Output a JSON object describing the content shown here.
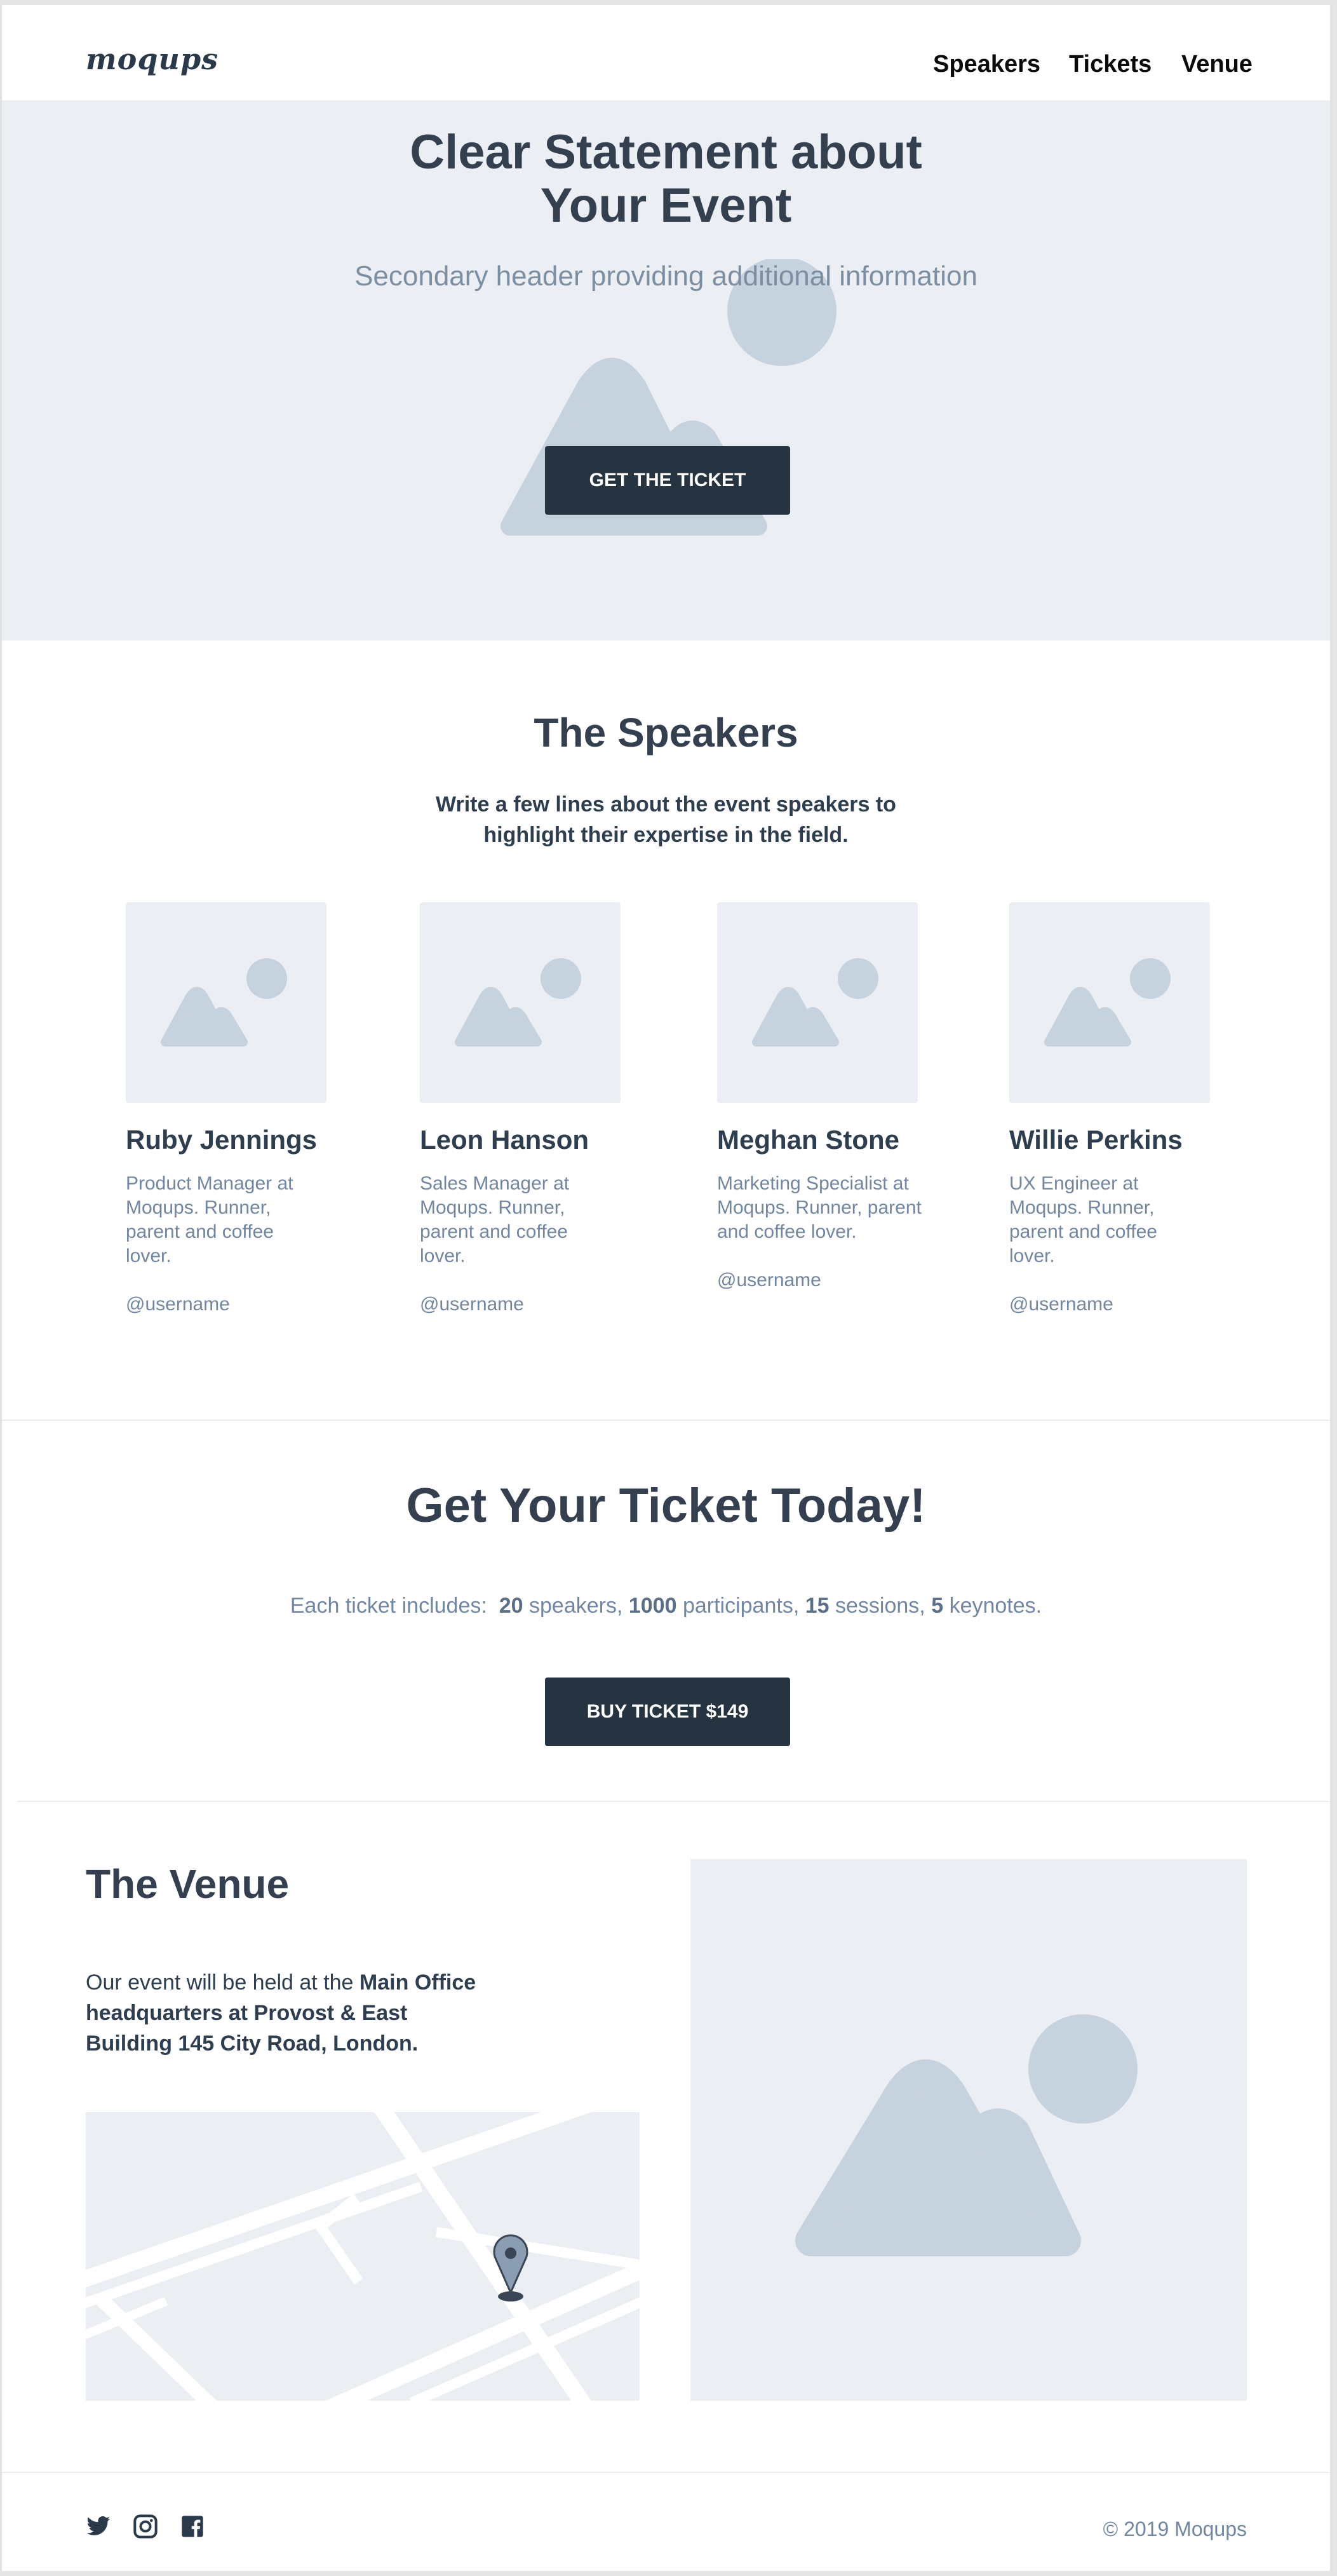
{
  "header": {
    "logo": "moqups",
    "nav": [
      "Speakers",
      "Tickets",
      "Venue"
    ]
  },
  "hero": {
    "title_line1": "Clear Statement about",
    "title_line2": "Your Event",
    "subtitle": "Secondary header providing additional information",
    "cta": "GET THE TICKET"
  },
  "speakers": {
    "title": "The Speakers",
    "intro_line1": "Write a few lines about the event speakers to",
    "intro_line2": "highlight their expertise in the field.",
    "items": [
      {
        "name": "Ruby Jennings",
        "bio": "Product Manager at Moqups. Runner, parent and coffee lover.",
        "username": "@username"
      },
      {
        "name": "Leon Hanson",
        "bio": "Sales Manager at Moqups.  Runner, parent and coffee lover.",
        "username": "@username"
      },
      {
        "name": "Meghan Stone",
        "bio": "Marketing Specialist at Moqups. Runner, parent and coffee lover.",
        "username": "@username"
      },
      {
        "name": "Willie Perkins",
        "bio": "UX Engineer at Moqups. Runner, parent and coffee lover.",
        "username": "@username"
      }
    ]
  },
  "tickets": {
    "title": "Get Your Ticket Today!",
    "includes_prefix": "Each ticket includes:",
    "speakers_count": "20",
    "speakers_label": "speakers,",
    "participants_count": "1000",
    "participants_label": "participants,",
    "sessions_count": "15",
    "sessions_label": "sessions,",
    "keynotes_count": "5",
    "keynotes_label": "keynotes.",
    "buy": "BUY TICKET $149"
  },
  "venue": {
    "title": "The Venue",
    "text_prefix": "Our event will be held at the",
    "text_bold": "Main Office headquarters at Provost & East Building 145 City Road, London."
  },
  "footer": {
    "icons": [
      "twitter-icon",
      "instagram-icon",
      "facebook-icon"
    ],
    "copyright": "© 2019  Moqups"
  },
  "colors": {
    "placeholder_bg": "#ebeff3",
    "placeholder_shape": "#c7d2df",
    "button": "#263341",
    "heading": "#34404f",
    "muted": "#7386a0"
  }
}
